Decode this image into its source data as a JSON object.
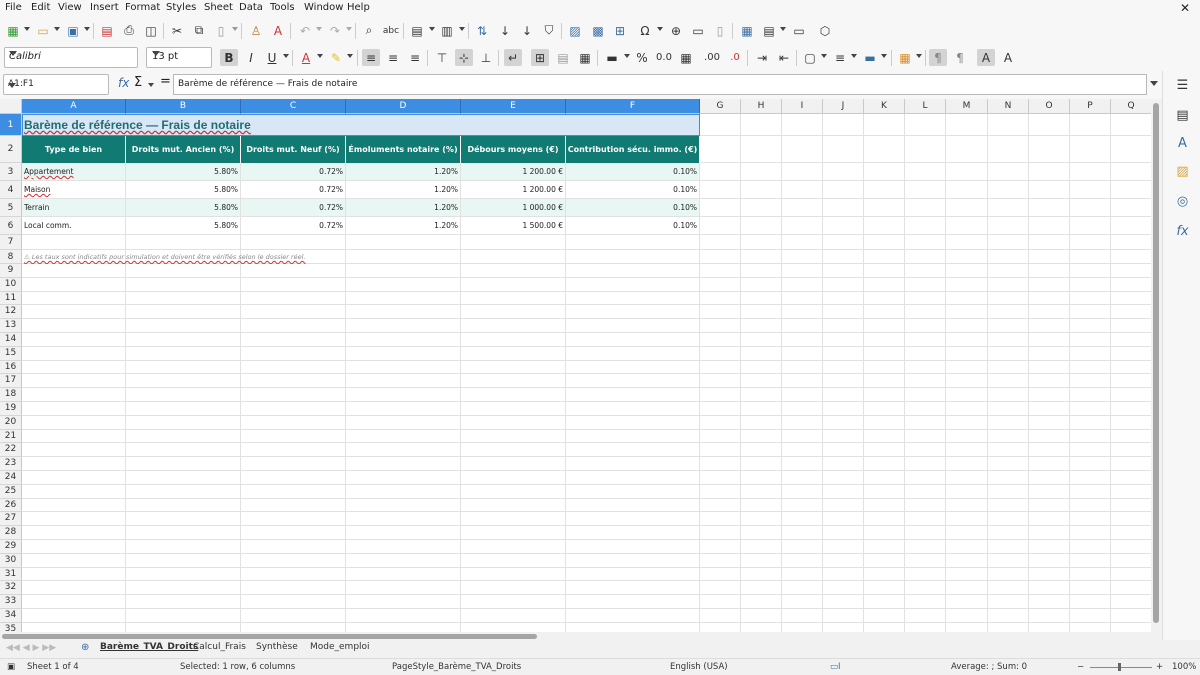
{
  "menu": [
    "File",
    "Edit",
    "View",
    "Insert",
    "Format",
    "Styles",
    "Sheet",
    "Data",
    "Tools",
    "Window",
    "Help"
  ],
  "font": {
    "name": "Calibri",
    "size": "13 pt"
  },
  "namebox": "A1:F1",
  "formula": "Barème de référence — Frais de notaire",
  "columns": [
    "A",
    "B",
    "C",
    "D",
    "E",
    "F",
    "G",
    "H",
    "I",
    "J",
    "K",
    "L",
    "M",
    "N",
    "O",
    "P",
    "Q"
  ],
  "rows": [
    "1",
    "2",
    "3",
    "4",
    "5",
    "6",
    "7",
    "8",
    "9",
    "10",
    "11",
    "12",
    "13",
    "14",
    "15",
    "16",
    "17",
    "18",
    "19",
    "20",
    "21",
    "22",
    "23",
    "24",
    "25",
    "26",
    "27",
    "28",
    "29",
    "30",
    "31",
    "32",
    "33",
    "34",
    "35"
  ],
  "sheet": {
    "title": "Barème de référence — Frais de notaire",
    "headers": [
      "Type de bien",
      "Droits mut. Ancien (%)",
      "Droits mut. Neuf (%)",
      "Émoluments notaire (%)",
      "Débours moyens (€)",
      "Contribution sécu. immo. (€)"
    ],
    "data": [
      [
        "Appartement",
        "5.80%",
        "0.72%",
        "1.20%",
        "1 200.00 €",
        "0.10%"
      ],
      [
        "Maison",
        "5.80%",
        "0.72%",
        "1.20%",
        "1 200.00 €",
        "0.10%"
      ],
      [
        "Terrain",
        "5.80%",
        "0.72%",
        "1.20%",
        "1 000.00 €",
        "0.10%"
      ],
      [
        "Local comm.",
        "5.80%",
        "0.72%",
        "1.20%",
        "1 500.00 €",
        "0.10%"
      ]
    ],
    "note": "⚠ Les taux sont indicatifs pour simulation et doivent être vérifiés selon le dossier réel."
  },
  "tabs": [
    "Barème_TVA_Droits",
    "Calcul_Frais",
    "Synthèse",
    "Mode_emploi"
  ],
  "status": {
    "sheet": "Sheet 1 of 4",
    "selection": "Selected: 1 row, 6 columns",
    "pagestyle": "PageStyle_Barème_TVA_Droits",
    "language": "English (USA)",
    "summary": "Average: ; Sum: 0",
    "zoom": "100%"
  },
  "colors": {
    "header_bg": "#117a73",
    "zebra": "#e8f6f4",
    "title": "#1e6e74",
    "selection": "#3d8ee3"
  }
}
